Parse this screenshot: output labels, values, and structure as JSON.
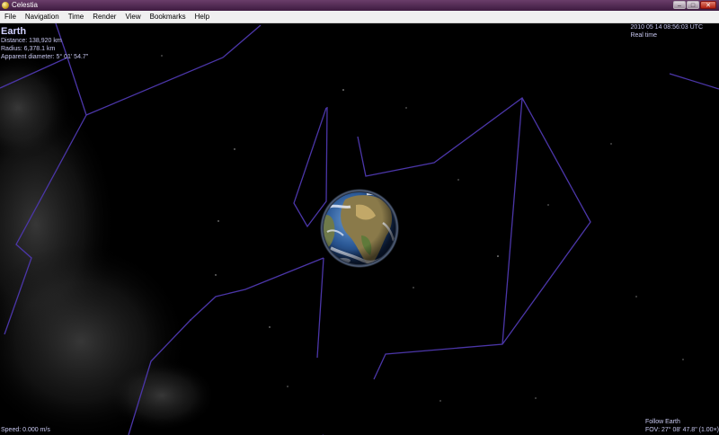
{
  "window": {
    "title": "Celestia",
    "minimize_label": "–",
    "maximize_label": "□",
    "close_label": "✕"
  },
  "menu": [
    "File",
    "Navigation",
    "Time",
    "Render",
    "View",
    "Bookmarks",
    "Help"
  ],
  "hud": {
    "object_name": "Earth",
    "distance": "Distance: 138,920 km",
    "radius": "Radius: 6,378.1 km",
    "apparent_diameter": "Apparent diameter: 5° 01' 54.7\"",
    "datetime": "2010 05 14 08:56:03 UTC",
    "time_mode": "Real time",
    "speed": "Speed: 0.000 m/s",
    "follow": "Follow Earth",
    "fov": "FOV: 27° 08' 47.8\" (1.00×)"
  },
  "colors": {
    "constellation_line": "#4b36a8",
    "hud_text": "#c8c8f0",
    "background": "#000000"
  },
  "icons": {
    "app": "celestia-app-icon",
    "planet": "earth-globe"
  }
}
